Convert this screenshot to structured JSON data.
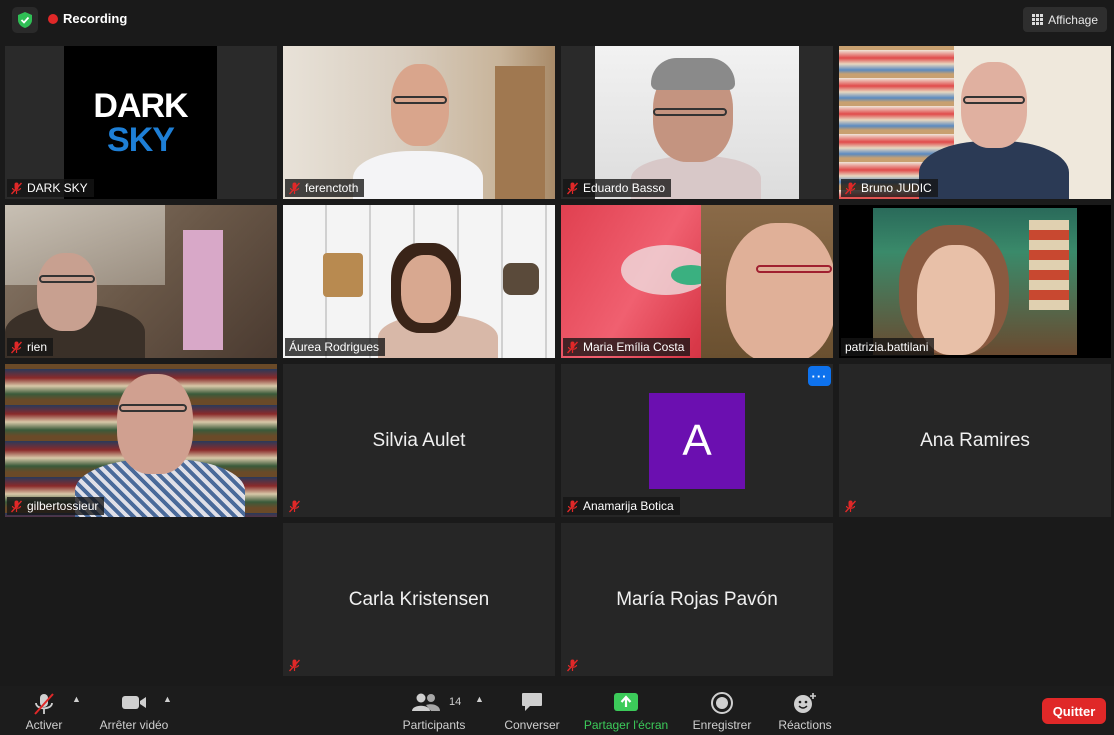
{
  "topbar": {
    "recording_label": "Recording",
    "view_label": "Affichage",
    "colors": {
      "recording_dot": "#e02828",
      "shield": "#2fbf55"
    }
  },
  "participants": [
    {
      "name": "DARK SKY",
      "muted": true,
      "video": true,
      "logo_text_1": "DARK",
      "logo_text_2": "SKY"
    },
    {
      "name": "ferenctoth",
      "muted": true,
      "video": true
    },
    {
      "name": "Eduardo Basso",
      "muted": true,
      "video": true
    },
    {
      "name": "Bruno JUDIC",
      "muted": true,
      "video": true
    },
    {
      "name": "rien",
      "muted": true,
      "video": true
    },
    {
      "name": "Áurea Rodrigues",
      "muted": false,
      "video": true
    },
    {
      "name": "Maria Emília  Costa",
      "muted": true,
      "video": true
    },
    {
      "name": "patrizia.battilani",
      "muted": false,
      "video": true,
      "active_speaker": true
    },
    {
      "name": "gilbertossieur",
      "muted": true,
      "video": true
    },
    {
      "name": "Silvia Aulet",
      "muted": true,
      "video": false
    },
    {
      "name": "Anamarija Botica",
      "muted": true,
      "video": false,
      "avatar_letter": "A",
      "more_label": "···"
    },
    {
      "name": "Ana Ramires",
      "muted": true,
      "video": false
    },
    {
      "name": "Carla Kristensen",
      "muted": true,
      "video": false
    },
    {
      "name": "María Rojas Pavón",
      "muted": true,
      "video": false
    }
  ],
  "toolbar": {
    "mute_label": "Activer",
    "video_label": "Arrêter vidéo",
    "participants_label": "Participants",
    "participants_count": "14",
    "chat_label": "Converser",
    "share_label": "Partager l'écran",
    "record_label": "Enregistrer",
    "reactions_label": "Réactions",
    "quit_label": "Quitter",
    "colors": {
      "share": "#3ccb5a",
      "quit": "#e02828"
    }
  }
}
